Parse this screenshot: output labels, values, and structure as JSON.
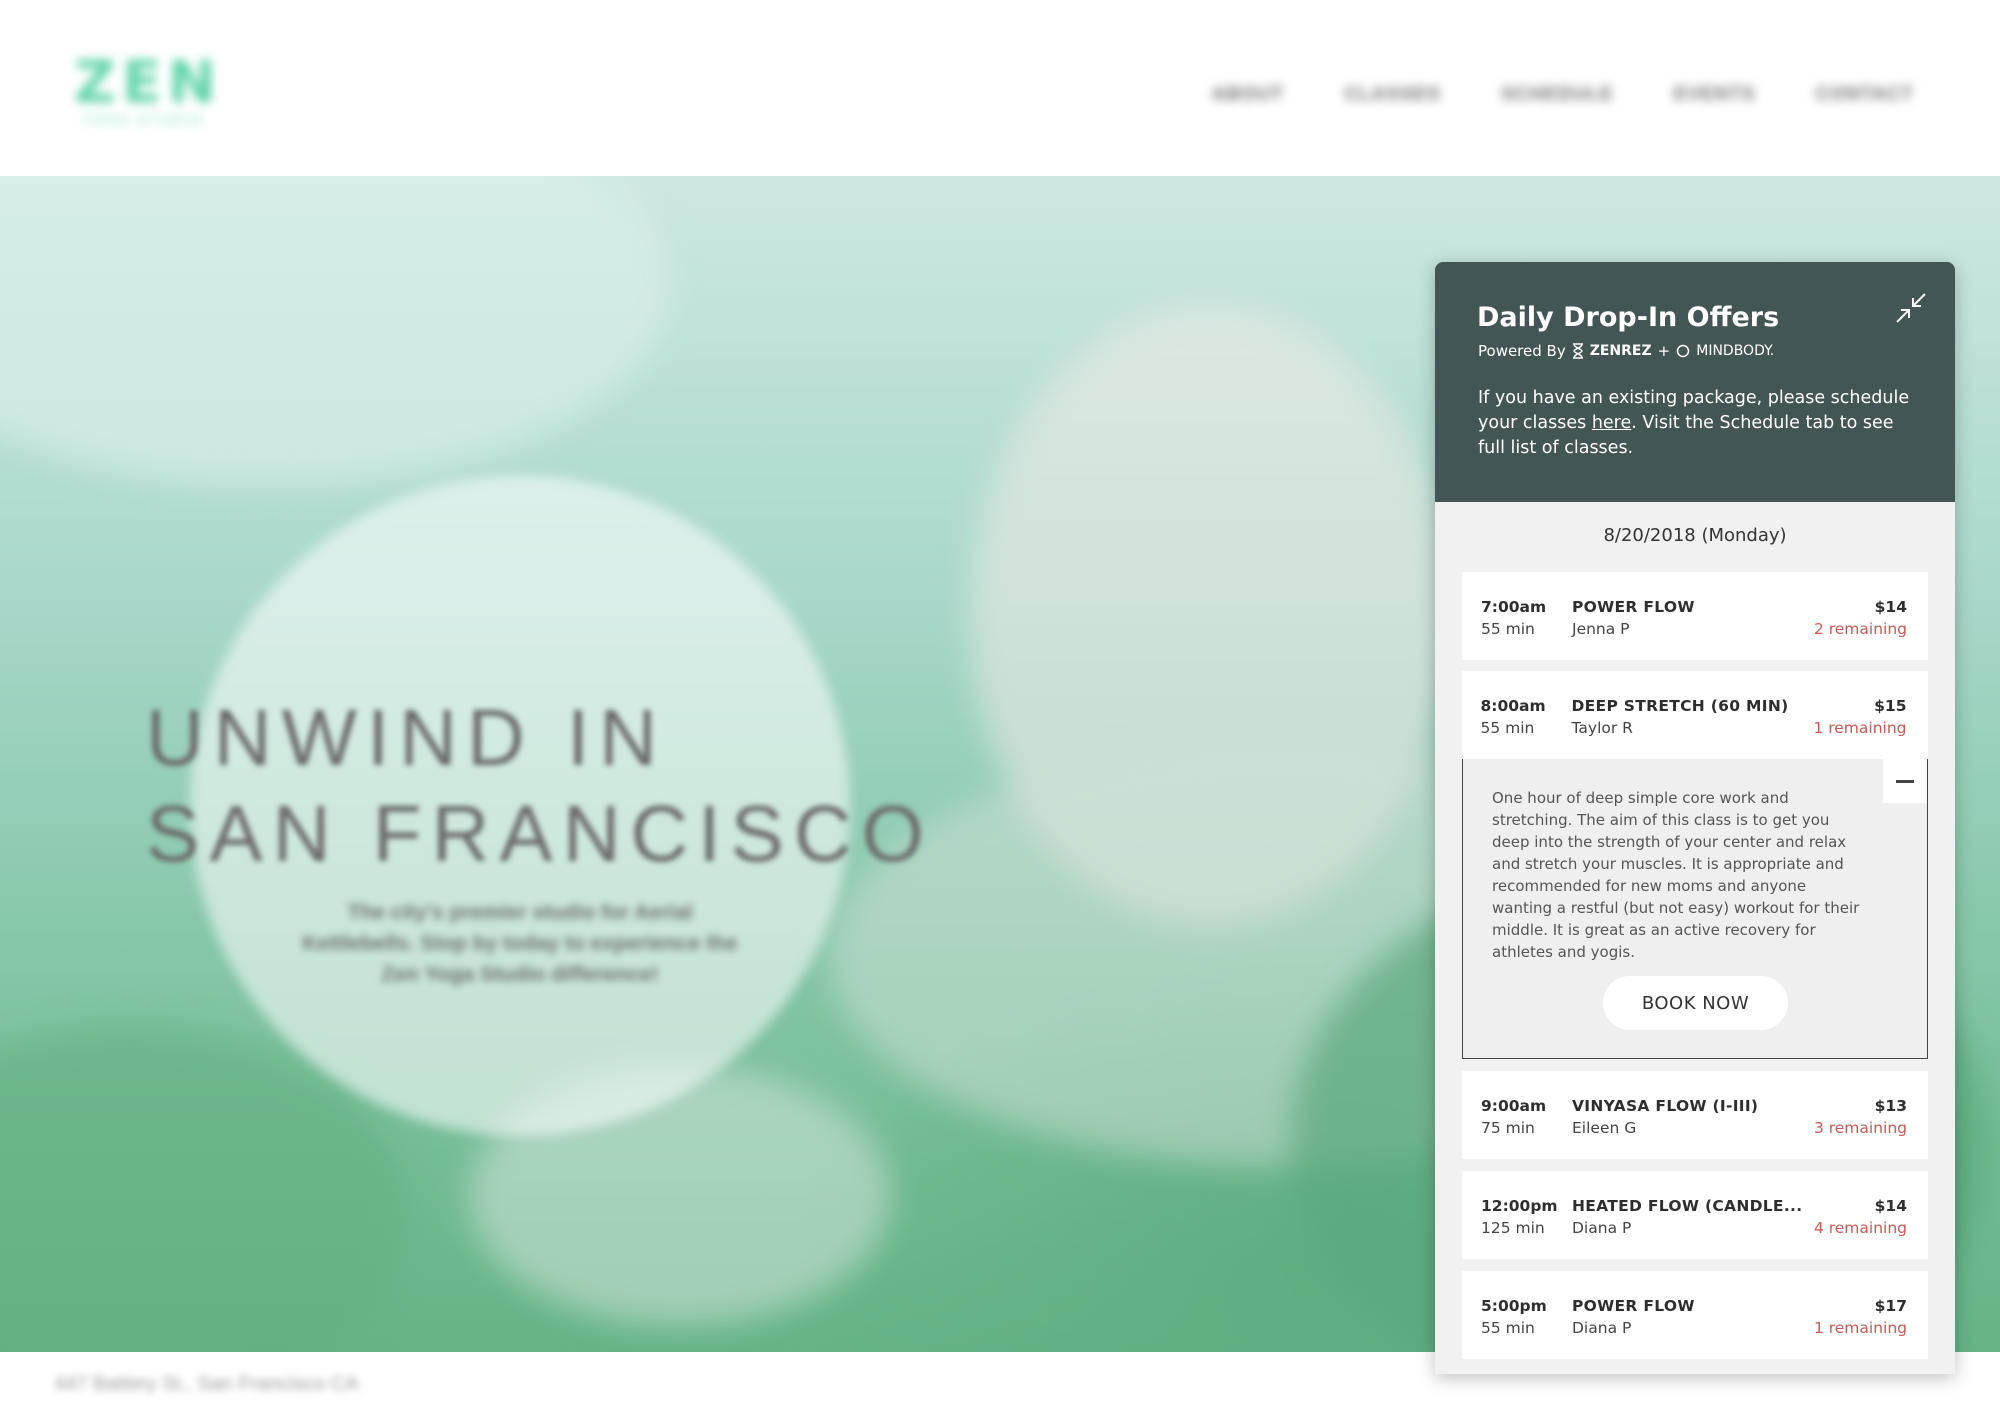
{
  "site": {
    "logo": "ZEN",
    "logo_sub": "YOGA STUDIO",
    "nav": [
      "ABOUT",
      "CLASSES",
      "SCHEDULE",
      "EVENTS",
      "CONTACT"
    ],
    "hero_title_line1": "UNWIND IN",
    "hero_title_line2": "SAN FRANCISCO",
    "hero_subtitle": "The city's premier studio for Aerial Kettlebells. Stop by today to experience the Zen Yoga Studio difference!",
    "address": "447 Battery St., San Francisco CA"
  },
  "widget": {
    "title": "Daily Drop-In Offers",
    "powered_by": "Powered By",
    "brand1": "ZENREZ",
    "plus": "+",
    "brand2": "MINDBODY.",
    "intro_before": "If you have an existing package, please schedule your classes ",
    "intro_link": "here",
    "intro_after": ". Visit the Schedule tab to see full list of classes.",
    "date": "8/20/2018 (Monday)",
    "book_label": "BOOK NOW",
    "classes": [
      {
        "time": "7:00am",
        "duration": "55 min",
        "name": "POWER FLOW",
        "instructor": "Jenna P",
        "price": "$14",
        "remaining": "2 remaining"
      },
      {
        "time": "8:00am",
        "duration": "55 min",
        "name": "DEEP STRETCH (60 MIN)",
        "instructor": "Taylor R",
        "price": "$15",
        "remaining": "1 remaining",
        "description": "One hour of deep simple core work and stretching. The aim of this class is to get you deep into the strength of your center and relax and stretch your muscles. It is appropriate and recommended for new moms and anyone wanting a restful (but not easy) workout for their middle. It is great as an active recovery for athletes and yogis."
      },
      {
        "time": "9:00am",
        "duration": "75 min",
        "name": "VINYASA FLOW (I-III)",
        "instructor": "Eileen G",
        "price": "$13",
        "remaining": "3 remaining"
      },
      {
        "time": "12:00pm",
        "duration": "125 min",
        "name": "HEATED FLOW (CANDLE...",
        "instructor": "Diana P",
        "price": "$14",
        "remaining": "4 remaining"
      },
      {
        "time": "5:00pm",
        "duration": "55 min",
        "name": "POWER FLOW",
        "instructor": "Diana P",
        "price": "$17",
        "remaining": "1 remaining"
      }
    ]
  },
  "colors": {
    "widget_header": "#435554",
    "remaining_text": "#c75a52",
    "logo": "#5fd4a6",
    "hero_green": "#65b387"
  }
}
